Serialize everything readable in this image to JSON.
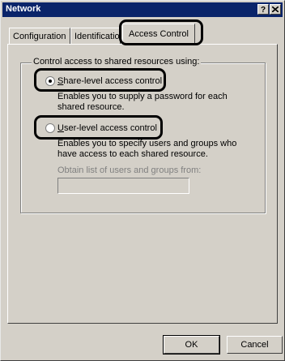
{
  "window": {
    "title": "Network",
    "help_button": "?",
    "close_button": "X"
  },
  "tabs": [
    {
      "label": "Configuration",
      "active": false
    },
    {
      "label": "Identificatio",
      "active": false
    },
    {
      "label": "Access Control",
      "active": true
    }
  ],
  "access_control": {
    "group_label": "Control access to shared resources using:",
    "options": [
      {
        "label": "Share-level access control",
        "accelerator": "S",
        "selected": true,
        "description": "Enables you to supply a password for each shared resource."
      },
      {
        "label": "User-level access control",
        "accelerator": "U",
        "selected": false,
        "description": "Enables you to specify users and groups who have access to each shared resource."
      }
    ],
    "obtain_list_label": "Obtain list of users and groups from:",
    "obtain_list_value": ""
  },
  "buttons": {
    "ok": "OK",
    "cancel": "Cancel"
  },
  "colors": {
    "titlebar": "#0a246a",
    "face": "#d4d0c8",
    "disabled_text": "#808080"
  }
}
